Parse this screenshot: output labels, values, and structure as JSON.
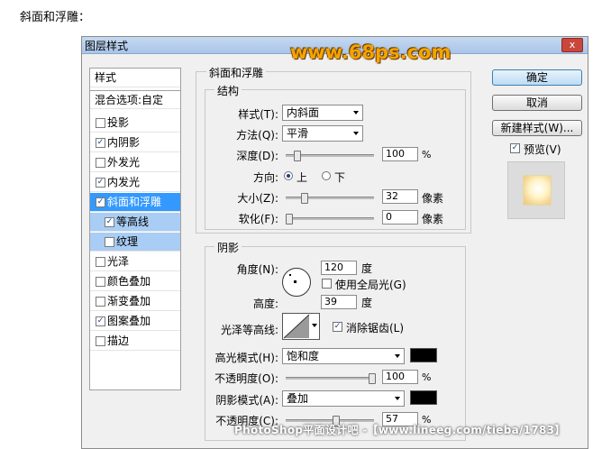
{
  "caption": "斜面和浮雕：",
  "dialog": {
    "title": "图层样式",
    "close_label": "x"
  },
  "style_list": {
    "header": "样式",
    "blend": "混合选项:自定",
    "items": [
      {
        "label": "投影",
        "checked": false
      },
      {
        "label": "内阴影",
        "checked": true
      },
      {
        "label": "外发光",
        "checked": false
      },
      {
        "label": "内发光",
        "checked": true
      },
      {
        "label": "斜面和浮雕",
        "checked": true
      },
      {
        "label": "等高线",
        "checked": true
      },
      {
        "label": "纹理",
        "checked": false
      },
      {
        "label": "光泽",
        "checked": false
      },
      {
        "label": "颜色叠加",
        "checked": false
      },
      {
        "label": "渐变叠加",
        "checked": false
      },
      {
        "label": "图案叠加",
        "checked": true
      },
      {
        "label": "描边",
        "checked": false
      }
    ],
    "check_mark": "✓"
  },
  "bevel": {
    "section_title": "斜面和浮雕",
    "structure_title": "结构",
    "style_label": "样式(T):",
    "style_value": "内斜面",
    "technique_label": "方法(Q):",
    "technique_value": "平滑",
    "depth_label": "深度(D):",
    "depth_value": "100",
    "depth_unit": "%",
    "depth_level": 0.1,
    "direction_label": "方向:",
    "dir_up": "上",
    "dir_down": "下",
    "size_label": "大小(Z):",
    "size_value": "32",
    "size_unit": "像素",
    "size_level": 0.18,
    "soften_label": "软化(F):",
    "soften_value": "0",
    "soften_unit": "像素",
    "soften_level": 0.0
  },
  "shading": {
    "title": "阴影",
    "angle_label": "角度(N):",
    "angle_value": "120",
    "angle_unit": "度",
    "global_light_label": "使用全局光(G)",
    "altitude_label": "高度:",
    "altitude_value": "39",
    "altitude_unit": "度",
    "gloss_label": "光泽等高线:",
    "antialias_label": "消除锯齿(L)",
    "highlight_mode_label": "高光模式(H):",
    "highlight_mode_value": "饱和度",
    "highlight_color": "#000000",
    "highlight_opacity_label": "不透明度(O):",
    "highlight_opacity_value": "100",
    "highlight_opacity_unit": "%",
    "highlight_opacity_level": 1.0,
    "shadow_mode_label": "阴影模式(A):",
    "shadow_mode_value": "叠加",
    "shadow_color": "#000000",
    "shadow_opacity_label": "不透明度(C):",
    "shadow_opacity_value": "57",
    "shadow_opacity_unit": "%",
    "shadow_opacity_level": 0.57
  },
  "buttons": {
    "ok": "确定",
    "cancel": "取消",
    "new_style": "新建样式(W)...",
    "preview_label": "预览(V)"
  },
  "watermark_logo": "www.68ps.com",
  "watermark_text": "PhotoShop平面设计吧 -【www.lineeg.com/tieba/1783】"
}
